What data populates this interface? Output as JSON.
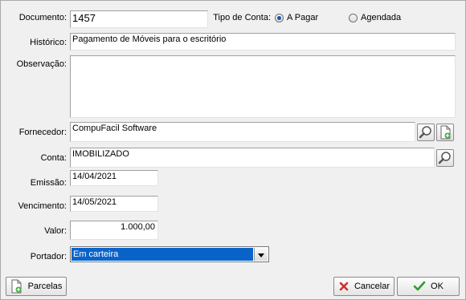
{
  "form": {
    "documento": {
      "label": "Documento:",
      "value": "1457"
    },
    "tipo_conta": {
      "label": "Tipo de Conta:",
      "options": [
        "A Pagar",
        "Agendada"
      ],
      "selected": "A Pagar"
    },
    "historico": {
      "label": "Histórico:",
      "value": "Pagamento de Móveis para o escritório"
    },
    "observacao": {
      "label": "Observação:",
      "value": ""
    },
    "fornecedor": {
      "label": "Fornecedor:",
      "value": "CompuFacil Software"
    },
    "conta": {
      "label": "Conta:",
      "value": "IMOBILIZADO"
    },
    "emissao": {
      "label": "Emissão:",
      "value": "14/04/2021"
    },
    "vencimento": {
      "label": "Vencimento:",
      "value": "14/05/2021"
    },
    "valor": {
      "label": "Valor:",
      "value": "1.000,00"
    },
    "portador": {
      "label": "Portador:",
      "value": "Em carteira"
    }
  },
  "buttons": {
    "parcelas": "Parcelas",
    "cancelar": "Cancelar",
    "ok": "OK"
  },
  "colors": {
    "selection": "#0a64c8",
    "cancel_icon": "#d03030",
    "ok_icon": "#2e9e2e",
    "window_bg": "#f0f0f0"
  }
}
